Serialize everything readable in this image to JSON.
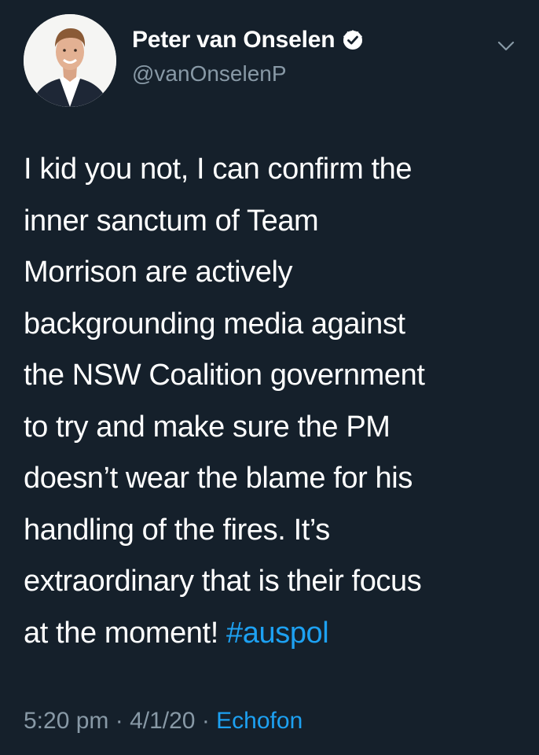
{
  "author": {
    "display_name": "Peter van Onselen",
    "handle": "@vanOnselenP",
    "verified": true
  },
  "tweet": {
    "text": "I kid you not, I can confirm the\ninner sanctum of Team\nMorrison are actively\nbackgrounding media against\nthe NSW Coalition government\nto try and make sure the PM\ndoesn’t wear the blame for his\nhandling of the fires. It’s\nextraordinary that is their focus\nat the moment! ",
    "hashtag": "#auspol"
  },
  "meta": {
    "time": "5:20 pm",
    "separator1": " · ",
    "date": "4/1/20",
    "separator2": " · ",
    "source": "Echofon"
  },
  "icons": {
    "verified": "verified-badge-icon",
    "menu": "chevron-down-icon"
  },
  "colors": {
    "background": "#15202b",
    "text": "#ffffff",
    "secondary": "#8899a6",
    "link": "#1da1f2"
  }
}
